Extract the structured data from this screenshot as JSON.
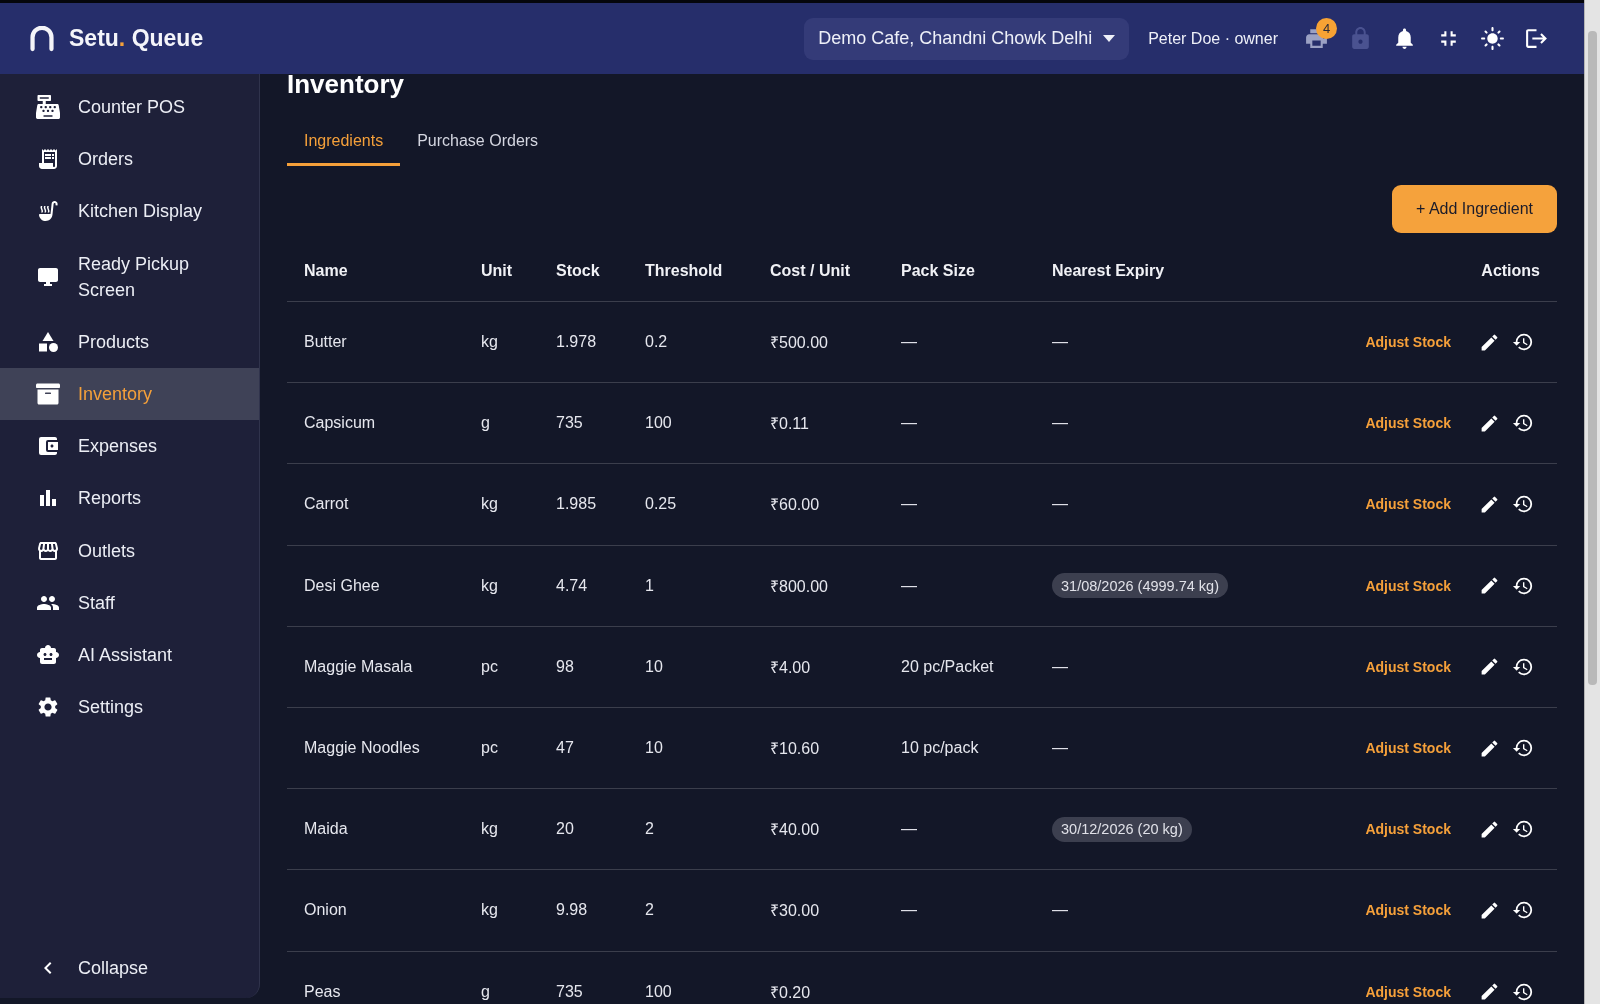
{
  "brand": {
    "name": "Setu",
    "accent": ".",
    "suffix": "Queue"
  },
  "outlet_select": {
    "value": "Demo Cafe, Chandni Chowk Delhi"
  },
  "user": "Peter Doe · owner",
  "toolbar": [
    {
      "badge": "4",
      "disabled": false
    },
    {
      "disabled": true
    },
    {
      "disabled": false
    },
    {
      "disabled": false
    },
    {
      "disabled": false
    },
    {
      "disabled": false
    }
  ],
  "sidebar": {
    "items": [
      {
        "label": "Counter POS",
        "selected": false
      },
      {
        "label": "Orders",
        "selected": false
      },
      {
        "label": "Kitchen Display",
        "selected": false
      },
      {
        "label": "Ready Pickup Screen",
        "selected": false
      },
      {
        "label": "Products",
        "selected": false
      },
      {
        "label": "Inventory",
        "selected": true
      },
      {
        "label": "Expenses",
        "selected": false
      },
      {
        "label": "Reports",
        "selected": false
      },
      {
        "label": "Outlets",
        "selected": false
      },
      {
        "label": "Staff",
        "selected": false
      },
      {
        "label": "AI Assistant",
        "selected": false
      },
      {
        "label": "Settings",
        "selected": false
      }
    ],
    "collapse": "Collapse"
  },
  "page": {
    "title": "Inventory",
    "tabs": [
      {
        "label": "Ingredients",
        "selected": true
      },
      {
        "label": "Purchase Orders",
        "selected": false
      }
    ],
    "add_button": "+ Add Ingredient"
  },
  "table": {
    "columns": [
      "Name",
      "Unit",
      "Stock",
      "Threshold",
      "Cost / Unit",
      "Pack Size",
      "Nearest Expiry",
      "Actions"
    ],
    "rows": [
      {
        "name": "Butter",
        "unit": "kg",
        "stock": "1.978",
        "threshold": "0.2",
        "cost": "₹500.00",
        "pack_size": "—",
        "expiry": {
          "kind": "dash",
          "text": "—"
        },
        "action": "Adjust Stock"
      },
      {
        "name": "Capsicum",
        "unit": "g",
        "stock": "735",
        "threshold": "100",
        "cost": "₹0.11",
        "pack_size": "—",
        "expiry": {
          "kind": "dash",
          "text": "—"
        },
        "action": "Adjust Stock"
      },
      {
        "name": "Carrot",
        "unit": "kg",
        "stock": "1.985",
        "threshold": "0.25",
        "cost": "₹60.00",
        "pack_size": "—",
        "expiry": {
          "kind": "dash",
          "text": "—"
        },
        "action": "Adjust Stock"
      },
      {
        "name": "Desi Ghee",
        "unit": "kg",
        "stock": "4.74",
        "threshold": "1",
        "cost": "₹800.00",
        "pack_size": "—",
        "expiry": {
          "kind": "badge",
          "text": "31/08/2026 (4999.74 kg)"
        },
        "action": "Adjust Stock"
      },
      {
        "name": "Maggie Masala",
        "unit": "pc",
        "stock": "98",
        "threshold": "10",
        "cost": "₹4.00",
        "pack_size": "20 pc/Packet",
        "expiry": {
          "kind": "dash",
          "text": "—"
        },
        "action": "Adjust Stock"
      },
      {
        "name": "Maggie Noodles",
        "unit": "pc",
        "stock": "47",
        "threshold": "10",
        "cost": "₹10.60",
        "pack_size": "10 pc/pack",
        "expiry": {
          "kind": "dash",
          "text": "—"
        },
        "action": "Adjust Stock"
      },
      {
        "name": "Maida",
        "unit": "kg",
        "stock": "20",
        "threshold": "2",
        "cost": "₹40.00",
        "pack_size": "—",
        "expiry": {
          "kind": "badge",
          "text": "30/12/2026 (20 kg)"
        },
        "action": "Adjust Stock"
      },
      {
        "name": "Onion",
        "unit": "kg",
        "stock": "9.98",
        "threshold": "2",
        "cost": "₹30.00",
        "pack_size": "—",
        "expiry": {
          "kind": "dash",
          "text": "—"
        },
        "action": "Adjust Stock"
      },
      {
        "name": "Peas",
        "unit": "g",
        "stock": "735",
        "threshold": "100",
        "cost": "₹0.20",
        "action": "Adjust Stock"
      }
    ]
  }
}
